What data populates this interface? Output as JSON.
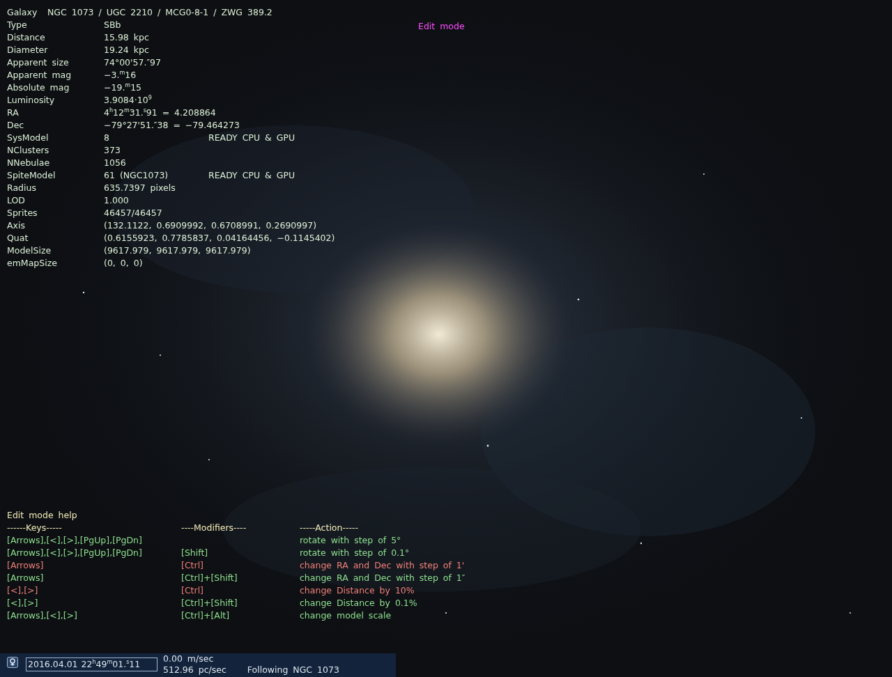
{
  "header": {
    "label": "Galaxy",
    "names": "NGC 1073 / UGC 2210 / MCG0-8-1 / ZWG 389.2"
  },
  "mode_label": "Edit mode",
  "info": [
    {
      "label": "Type",
      "value": "SBb"
    },
    {
      "label": "Distance",
      "value": "15.98 kpc"
    },
    {
      "label": "Diameter",
      "value": "19.24 kpc"
    },
    {
      "label": "Apparent size",
      "value": "74°00'57.″97"
    },
    {
      "label": "Apparent mag",
      "value": "−3.$^{m}$16"
    },
    {
      "label": "Absolute mag",
      "value": "−19.$^{m}$15"
    },
    {
      "label": "Luminosity",
      "value": "3.9084·10$^{9}$"
    },
    {
      "label": "RA",
      "value": "4$^{h}$12$^{m}$31.$^{s}$91 = 4.208864"
    },
    {
      "label": "Dec",
      "value": "−79°27'51.″38 = −79.464273"
    },
    {
      "label": "SysModel",
      "value": "8",
      "status": "READY CPU & GPU"
    },
    {
      "label": "NClusters",
      "value": "373"
    },
    {
      "label": "NNebulae",
      "value": "1056"
    },
    {
      "label": "SpiteModel",
      "value": "61 (NGC1073)",
      "status": "READY CPU & GPU"
    },
    {
      "label": "Radius",
      "value": "635.7397 pixels"
    },
    {
      "label": "LOD",
      "value": "1.000"
    },
    {
      "label": "Sprites",
      "value": "46457/46457"
    },
    {
      "label": "Axis",
      "value": "(132.1122, 0.6909992, 0.6708991, 0.2690997)"
    },
    {
      "label": "Quat",
      "value": "(0.6155923, 0.7785837, 0.04164456, −0.1145402)"
    },
    {
      "label": "ModelSize",
      "value": "(9617.979, 9617.979, 9617.979)"
    },
    {
      "label": "emMapSize",
      "value": "(0, 0, 0)"
    }
  ],
  "help": {
    "title": "Edit mode help",
    "columns": [
      "------Keys-----",
      "----Modifiers----",
      "-----Action-----"
    ],
    "rows": [
      {
        "keys": "[Arrows],[<],[>],[PgUp],[PgDn]",
        "action": "rotate with step of 5°",
        "color": "#8ee08e"
      },
      {
        "keys": "[Arrows],[<],[>],[PgUp],[PgDn]",
        "modifiers": "[Shift]",
        "action": "rotate with step of 0.1°",
        "color": "#8ee08e"
      },
      {
        "keys": "[Arrows]",
        "modifiers": "[Ctrl]",
        "action": "change RA and Dec with step of 1'",
        "color": "#f08078"
      },
      {
        "keys": "[Arrows]",
        "modifiers": "[Ctrl]+[Shift]",
        "action": "change RA and Dec with step of 1″",
        "color": "#8ee08e"
      },
      {
        "keys": "[<],[>]",
        "modifiers": "[Ctrl]",
        "action": "change Distance by 10%",
        "color": "#f08078"
      },
      {
        "keys": "[<],[>]",
        "modifiers": "[Ctrl]+[Shift]",
        "action": "change Distance by 0.1%",
        "color": "#8ee08e"
      },
      {
        "keys": "[Arrows],[<],[>]",
        "modifiers": "[Ctrl]+[Alt]",
        "action": "change model scale",
        "color": "#8ee08e"
      }
    ]
  },
  "status_bar": {
    "datetime": "2016.04.01  22$^{h}$49$^{m}$01.$^{s}$11",
    "speed": "0.00 m/sec",
    "rate": "512.96 pc/sec",
    "following": "Following NGC 1073"
  }
}
